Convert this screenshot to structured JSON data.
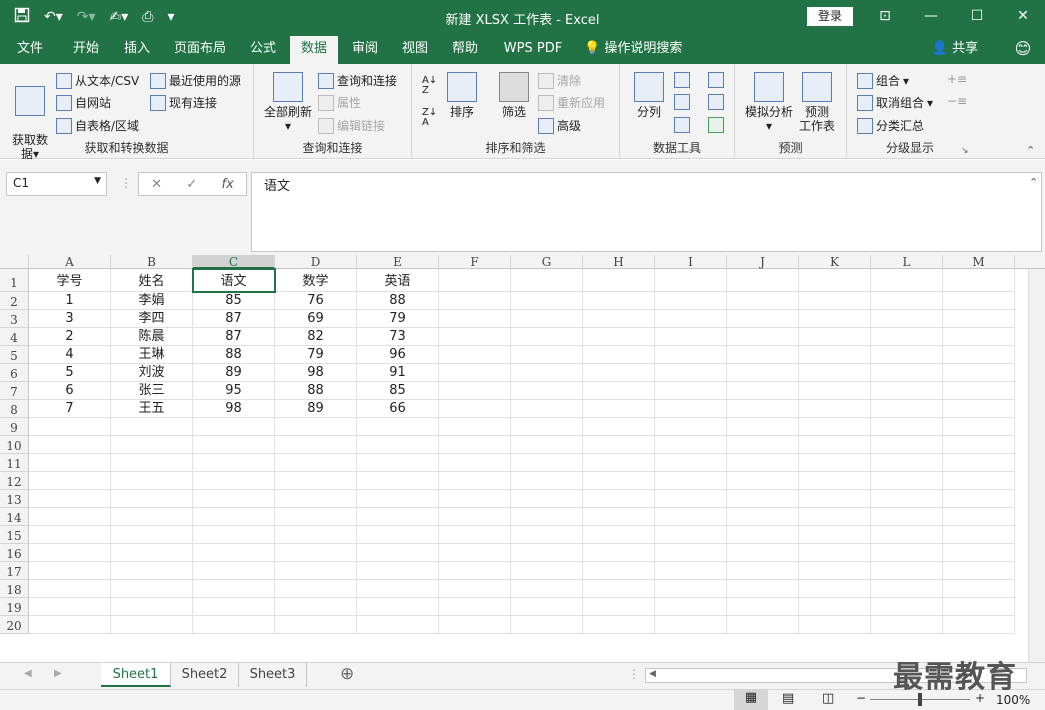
{
  "window": {
    "title": "新建 XLSX 工作表 - Excel",
    "login_label": "登录"
  },
  "tabs": [
    "文件",
    "开始",
    "插入",
    "页面布局",
    "公式",
    "数据",
    "审阅",
    "视图",
    "帮助",
    "WPS PDF"
  ],
  "tell_me": "操作说明搜索",
  "share_label": "共享",
  "ribbon": {
    "get_data": {
      "big": "获取数\n据",
      "from_text": "从文本/CSV",
      "from_web": "自网站",
      "from_table": "自表格/区域",
      "recent": "最近使用的源",
      "existing": "现有连接",
      "label": "获取和转换数据"
    },
    "queries": {
      "refresh_all": "全部刷新",
      "queries_conn": "查询和连接",
      "properties": "属性",
      "edit_links": "编辑链接",
      "label": "查询和连接"
    },
    "sort": {
      "sort": "排序",
      "filter": "筛选",
      "clear": "清除",
      "reapply": "重新应用",
      "advanced": "高级",
      "label": "排序和筛选"
    },
    "tools": {
      "split": "分列",
      "label": "数据工具"
    },
    "forecast": {
      "whatif": "模拟分析",
      "sheet": "预测\n工作表",
      "label": "预测"
    },
    "outline": {
      "group": "组合",
      "ungroup": "取消组合",
      "subtotal": "分类汇总",
      "label": "分级显示"
    }
  },
  "namebox": "C1",
  "formula": "语文",
  "columns": [
    "A",
    "B",
    "C",
    "D",
    "E",
    "F",
    "G",
    "H",
    "I",
    "J",
    "K",
    "L",
    "M"
  ],
  "rows": [
    "1",
    "2",
    "3",
    "4",
    "5",
    "6",
    "7",
    "8",
    "9",
    "10",
    "11",
    "12",
    "13",
    "14",
    "15",
    "16",
    "17",
    "18",
    "19",
    "20"
  ],
  "table": [
    [
      "学号",
      "姓名",
      "语文",
      "数学",
      "英语"
    ],
    [
      "1",
      "李娟",
      "85",
      "76",
      "88"
    ],
    [
      "3",
      "李四",
      "87",
      "69",
      "79"
    ],
    [
      "2",
      "陈晨",
      "87",
      "82",
      "73"
    ],
    [
      "4",
      "王琳",
      "88",
      "79",
      "96"
    ],
    [
      "5",
      "刘波",
      "89",
      "98",
      "91"
    ],
    [
      "6",
      "张三",
      "95",
      "88",
      "85"
    ],
    [
      "7",
      "王五",
      "98",
      "89",
      "66"
    ]
  ],
  "sheets": [
    "Sheet1",
    "Sheet2",
    "Sheet3"
  ],
  "zoom": "100%",
  "watermark": "最需教育",
  "colors": {
    "accent": "#217346"
  }
}
